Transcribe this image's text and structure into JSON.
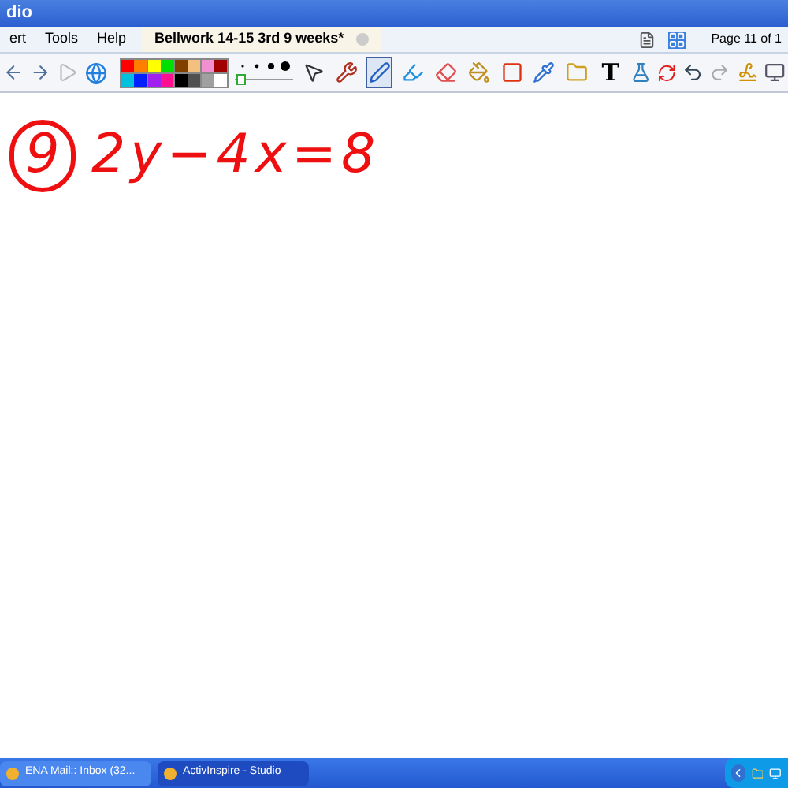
{
  "window": {
    "title": "dio"
  },
  "menu": [
    "ert",
    "Tools",
    "Help"
  ],
  "tabs": [
    {
      "label": "Bellwork 14-15 3rd 9 weeks*",
      "selected": true
    }
  ],
  "page_indicator": "Page 11 of 1",
  "palette": [
    {
      "color": "#ff0000"
    },
    {
      "color": "#ff8000"
    },
    {
      "color": "#ffff00"
    },
    {
      "color": "#00e000"
    },
    {
      "color": "#804000"
    },
    {
      "color": "#f4c080"
    },
    {
      "color": "#f090d0"
    },
    {
      "color": "#a00000"
    },
    {
      "color": "#00c0e0"
    },
    {
      "color": "#0020ff"
    },
    {
      "color": "#a020f0"
    },
    {
      "color": "#ff1090"
    },
    {
      "color": "#000000"
    },
    {
      "color": "#505050"
    },
    {
      "color": "#a0a0a0"
    },
    {
      "color": "#ffffff"
    }
  ],
  "pen_width": {
    "level": 0.05
  },
  "tools": [
    {
      "kind": "pointer",
      "selected": false
    },
    {
      "kind": "tools",
      "selected": false
    },
    {
      "kind": "pen",
      "selected": true
    },
    {
      "kind": "highlighter",
      "selected": false
    },
    {
      "kind": "eraser",
      "selected": false
    },
    {
      "kind": "fill",
      "selected": false
    },
    {
      "kind": "shape",
      "selected": false
    },
    {
      "kind": "connector",
      "selected": false
    },
    {
      "kind": "folder",
      "selected": false
    },
    {
      "kind": "text",
      "selected": false
    }
  ],
  "text_tool_glyph": "T",
  "ink": {
    "number": "9",
    "equation": "2y−4x=8"
  },
  "taskbar": [
    {
      "label": "ENA Mail:: Inbox (32...",
      "selected": false
    },
    {
      "label": "ActivInspire - Studio",
      "selected": true
    }
  ]
}
